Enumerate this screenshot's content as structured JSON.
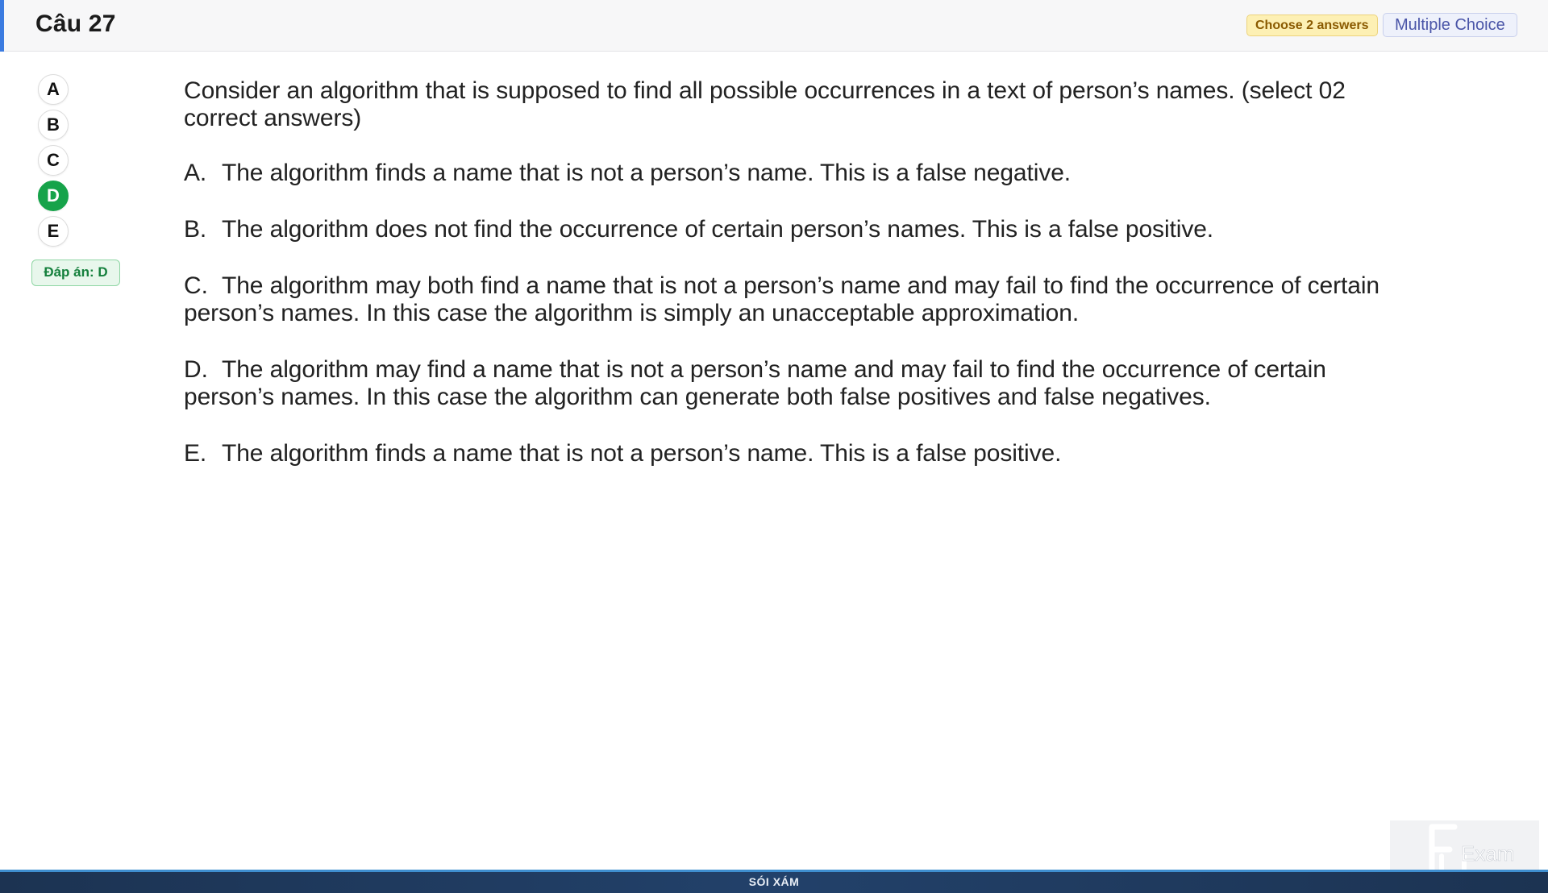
{
  "header": {
    "title": "Câu 27",
    "choose_badge": "Choose 2 answers",
    "type_badge": "Multiple Choice",
    "accent_color": "#3b7be0"
  },
  "sidebar": {
    "options": [
      {
        "letter": "A",
        "selected": false
      },
      {
        "letter": "B",
        "selected": false
      },
      {
        "letter": "C",
        "selected": false
      },
      {
        "letter": "D",
        "selected": true
      },
      {
        "letter": "E",
        "selected": false
      }
    ],
    "answer_tag": "Đáp án: D",
    "selected_color": "#16a34a"
  },
  "question": {
    "stem": "Consider an algorithm that is supposed to find all possible occurrences in a text of person’s names. (select 02 correct answers)",
    "options": [
      {
        "label": "A.",
        "text": "The algorithm finds a name that is not a person’s name. This is a false negative."
      },
      {
        "label": "B.",
        "text": "The algorithm does not find the occurrence of certain person’s names. This is a false positive."
      },
      {
        "label": "C.",
        "text": "The algorithm may both find a name that is not a person’s name and may fail to find the occurrence of certain person’s names. In this case the algorithm is simply an unacceptable approximation."
      },
      {
        "label": "D.",
        "text": "The algorithm may find a name that is not a person’s name and may fail to find the occurrence of certain person’s names. In this case the algorithm can generate both false positives and false negatives."
      },
      {
        "label": "E.",
        "text": "The algorithm finds a name that is not a person’s name. This is a false positive."
      }
    ]
  },
  "footer": {
    "text": "SÓI XÁM"
  },
  "logo": {
    "text": "FU Exam"
  }
}
